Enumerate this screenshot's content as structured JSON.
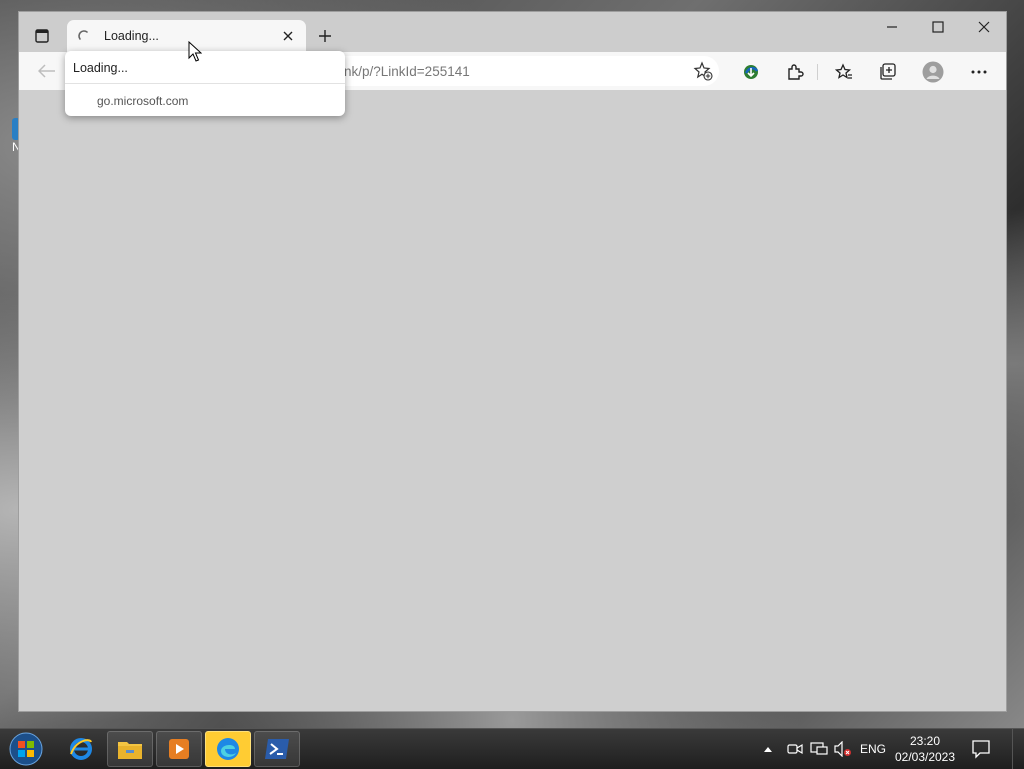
{
  "desktop": {
    "icon_label_fragment": "N"
  },
  "browser": {
    "tab": {
      "title": "Loading..."
    },
    "new_tab_symbol": "+",
    "address": {
      "url": "nk/p/?LinkId=255141"
    },
    "hover_card": {
      "title": "Loading...",
      "domain": "go.microsoft.com"
    },
    "icons": [
      "tab-actions-icon",
      "loading-spinner-icon",
      "close-icon",
      "plus-icon",
      "minimize-icon",
      "maximize-icon",
      "close-window-icon",
      "back-arrow-icon",
      "favorite-add-icon",
      "download-manager-icon",
      "extensions-icon",
      "favorites-icon",
      "collections-icon",
      "profile-icon",
      "more-icon"
    ]
  },
  "taskbar": {
    "apps": [
      "start-button",
      "internet-explorer",
      "file-explorer",
      "media-player",
      "edge",
      "powershell"
    ],
    "tray": {
      "language": "ENG",
      "time": "23:20",
      "date": "02/03/2023"
    }
  },
  "colors": {
    "accent_active_taskbar": "#ffcc33",
    "content_bg": "#cfcfcf"
  }
}
